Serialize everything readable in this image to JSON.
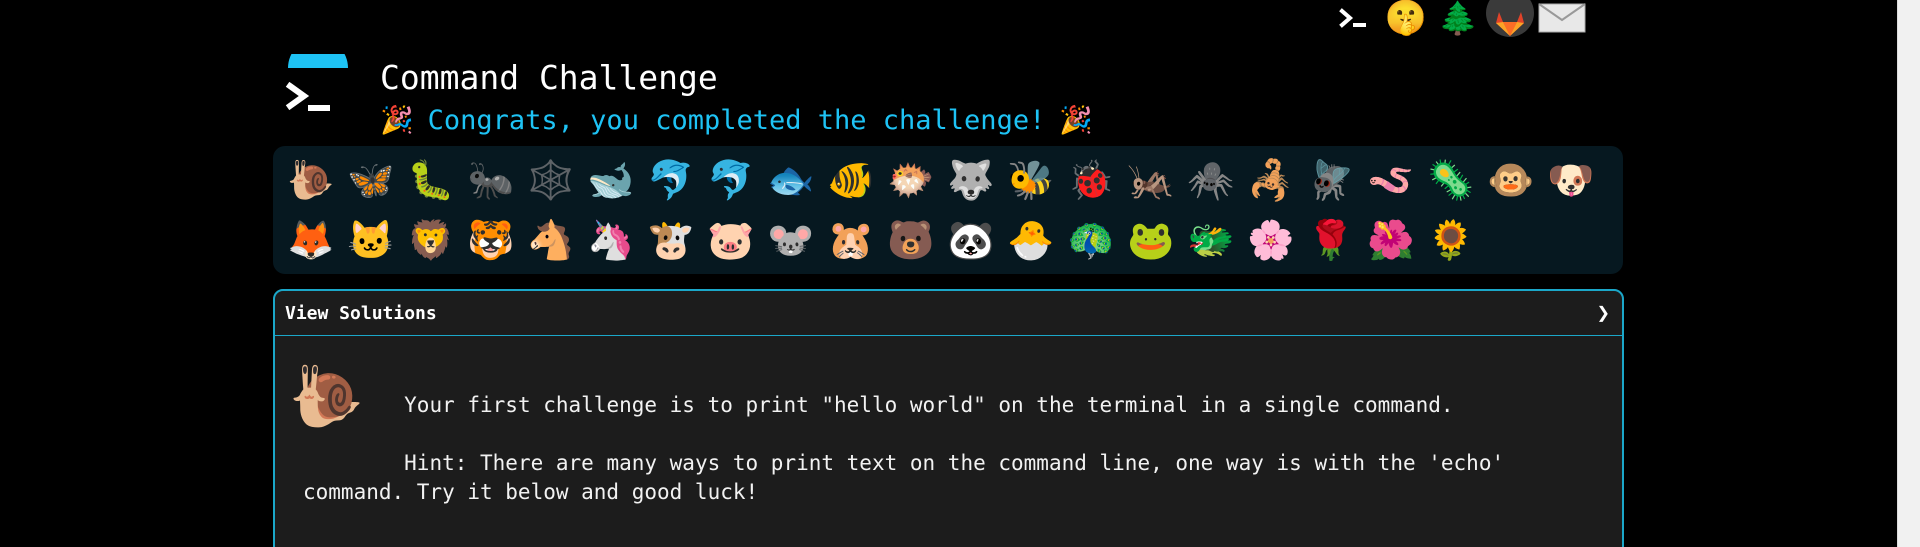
{
  "header": {
    "title": "Command Challenge",
    "subtitle": "Congrats, you completed the challenge!",
    "party_emoji": "🎉"
  },
  "top_icons": [
    {
      "name": "terminal-icon",
      "glyph": ">_"
    },
    {
      "name": "shush-face-icon",
      "glyph": "🤫"
    },
    {
      "name": "tree-icon",
      "glyph": "🌲"
    },
    {
      "name": "gitlab-icon",
      "glyph": "🦊"
    },
    {
      "name": "mail-icon",
      "glyph": "✉"
    }
  ],
  "animals_row1": [
    "🐌",
    "🦋",
    "🐛",
    "🐜",
    "🕸️",
    "🐋",
    "🐬",
    "🐬",
    "🐟",
    "🐠",
    "🐡",
    "🐺",
    "🐝",
    "🐞",
    "🦗",
    "🕷️",
    "🦂",
    "🪰",
    "🪱",
    "🦠",
    "🐵",
    "🐶"
  ],
  "animals_row2": [
    "🦊",
    "🐱",
    "🦁",
    "🐯",
    "🐴",
    "🦄",
    "🐮",
    "🐷",
    "🐭",
    "🐹",
    "🐻",
    "🐼",
    "🐣",
    "🦚",
    "🐸",
    "🐲",
    "🌸",
    "🌹",
    "🌺",
    "🌻"
  ],
  "panel": {
    "heading": "View Solutions",
    "chevron": "❯",
    "snail": "🐌",
    "challenge_text": "        Your first challenge is to print \"hello world\" on the terminal in a single command.\n\n        Hint: There are many ways to print text on the command line, one way is with the 'echo' command. Try it below and good luck!"
  },
  "colors": {
    "accent": "#1ec3f5",
    "panel_border": "#1ba7c9",
    "strip_bg": "#061820",
    "panel_bg": "#1c1c1c"
  }
}
